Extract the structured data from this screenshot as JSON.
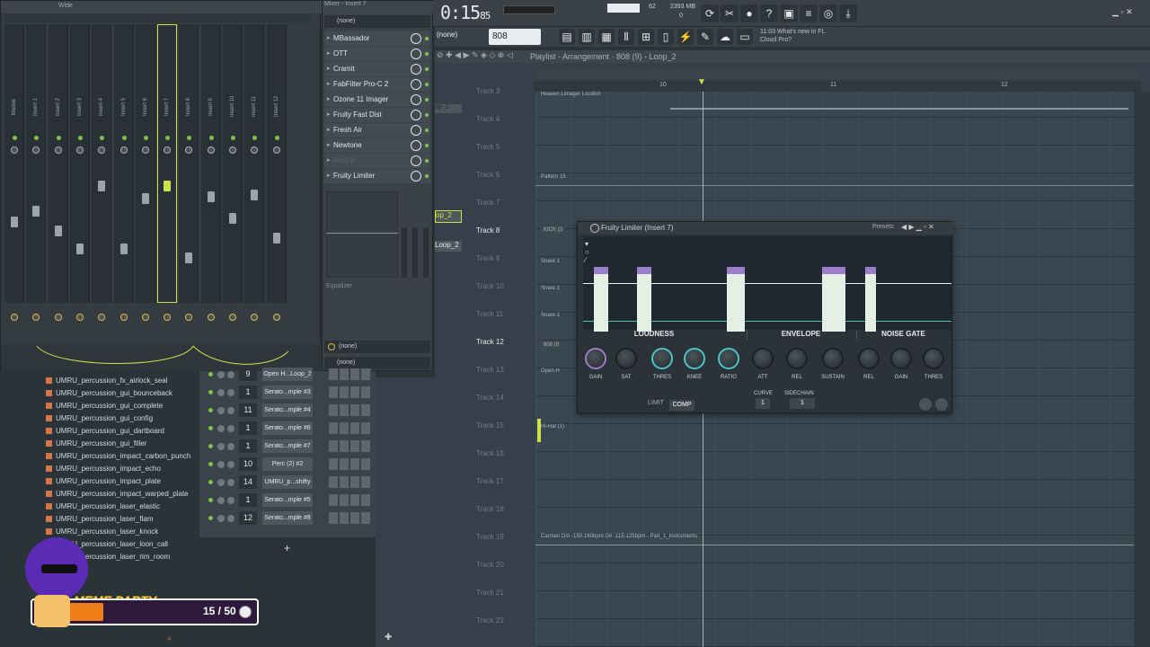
{
  "topbar": {
    "time_main": "0:15",
    "time_frac": "85",
    "cpu_value": "62",
    "ram_value": "2393 MB",
    "ram_sub": "0",
    "pattern_label": "808 (9...op_2",
    "snap_label": "(none)",
    "hint_time": "11:03",
    "hint_line1": "What's new in FL",
    "hint_line2": "Cloud Pro?"
  },
  "mixer": {
    "title": "Mixer - Insert 7",
    "top_label": "Wide",
    "strips": [
      "Master",
      "Insert 1",
      "Insert 2",
      "Insert 3",
      "Insert 4",
      "Insert 5",
      "Insert 6",
      "Insert 7",
      "Insert 8",
      "Insert 9",
      "Insert 10",
      "Insert 11",
      "Insert 12"
    ],
    "selected_index": 7
  },
  "fx_chain": {
    "input": "(none)",
    "slots": [
      "MBassador",
      "OTT",
      "Cramit",
      "FabFilter Pro-C 2",
      "Ozone 11 Imager",
      "Fruity Fast Dist",
      "Fresh Air",
      "Newtone",
      "Auto 9",
      "Fruity Limiter"
    ],
    "eq_label": "Equalizer",
    "output1": "(none)",
    "output2": "(none)"
  },
  "browser": {
    "items": [
      "UMRU_percussion_fx_airlock_seal",
      "UMRU_percussion_gui_bounceback",
      "UMRU_percussion_gui_complete",
      "UMRU_percussion_gui_config",
      "UMRU_percussion_gui_dartboard",
      "UMRU_percussion_gui_filler",
      "UMRU_percussion_impact_carbon_punch",
      "UMRU_percussion_impact_echo",
      "UMRU_percussion_impact_plate",
      "UMRU_percussion_impact_warped_plate",
      "UMRU_percussion_laser_elastic",
      "UMRU_percussion_laser_flam",
      "UMRU_percussion_laser_knock",
      "UMRU_percussion_laser_loon_call",
      "UMRU_percussion_laser_rim_room"
    ]
  },
  "channel_rack": {
    "rows": [
      {
        "num": "9",
        "name": "Open H...Loop_2"
      },
      {
        "num": "1",
        "name": "Serato...mple #3"
      },
      {
        "num": "11",
        "name": "Serato...mple #4"
      },
      {
        "num": "1",
        "name": "Serato...mple #6"
      },
      {
        "num": "1",
        "name": "Serato...mple #7"
      },
      {
        "num": "10",
        "name": "Perc (2) #2"
      },
      {
        "num": "14",
        "name": "UMRU_p...shifty"
      },
      {
        "num": "1",
        "name": "Serato...mple #5"
      },
      {
        "num": "12",
        "name": "Serato...mple #8"
      }
    ],
    "add_label": "+"
  },
  "playlist": {
    "breadcrumb": "Playlist - Arrangement · 808 (9) - Loop_2",
    "timeline_marks": [
      "10",
      "11",
      "12"
    ],
    "tracks": [
      "Track 3",
      "Track 4",
      "Track 5",
      "Track 6",
      "Track 7",
      "Track 8",
      "Track 9",
      "Track 10",
      "Track 11",
      "Track 12",
      "Track 13",
      "Track 14",
      "Track 15",
      "Track 16",
      "Track 17",
      "Track 18",
      "Track 19",
      "Track 20",
      "Track 21",
      "Track 22"
    ],
    "highlight_tracks": [
      "Track 8",
      "Track 12"
    ],
    "clips": {
      "track3": "Heaven Limager Loudish",
      "track6": "Pattern 15",
      "track8": "KICK (3",
      "track9": "Snare 1",
      "track10": "Snare 1",
      "track11": "Snare 1",
      "track12": "808 (9",
      "track13": "Open H",
      "track15": "Hi-Hat (1)",
      "track19": "Carmen Dm -150-160bpm G# -115-125bpm - Part_1_Instruments"
    },
    "left_labels": [
      "op_2",
      "Loop_2"
    ]
  },
  "limiter": {
    "title": "Fruity Limiter (Insert 7)",
    "presets": "Presets",
    "sections": [
      "LOUDNESS",
      "ENVELOPE",
      "NOISE GATE"
    ],
    "knobs": [
      "GAIN",
      "SAT",
      "THRES",
      "KNEE",
      "RATIO",
      "ATT",
      "REL",
      "SUSTAIN",
      "REL",
      "GAIN",
      "THRES"
    ],
    "curve_label": "CURVE",
    "curve_value": "1",
    "sidechain_label": "SIDECHAIN",
    "sidechain_value": "1",
    "mode_limit": "LIMIT",
    "mode_comp": "COMP"
  },
  "overlay": {
    "title": "MEME PARTY",
    "score": "15 / 50",
    "progress": 0.3
  }
}
